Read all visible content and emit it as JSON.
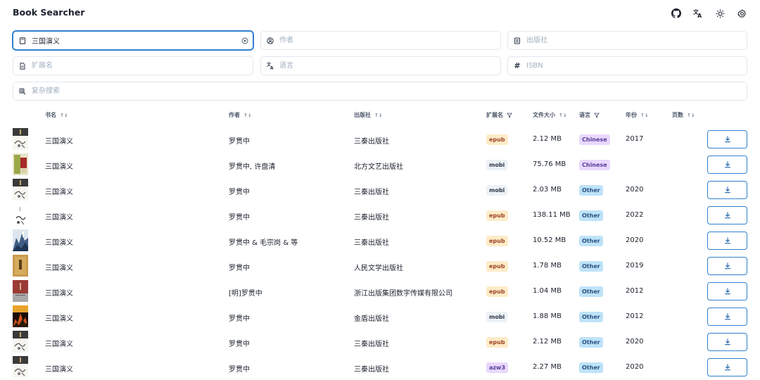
{
  "app": {
    "title": "Book Searcher"
  },
  "header_icons": [
    "github-icon",
    "translate-icon",
    "sun-icon",
    "gear-icon"
  ],
  "search": {
    "title": {
      "value": "三国演义",
      "placeholder": "书名"
    },
    "author": {
      "value": "",
      "placeholder": "作者"
    },
    "publisher": {
      "value": "",
      "placeholder": "出版社"
    },
    "extension": {
      "value": "",
      "placeholder": "扩展名"
    },
    "language": {
      "value": "",
      "placeholder": "语言"
    },
    "isbn": {
      "value": "",
      "placeholder": "ISBN",
      "icon_glyph": "#"
    },
    "complex": {
      "value": "",
      "placeholder": "复杂搜索"
    }
  },
  "table": {
    "headers": {
      "title": "书名",
      "author": "作者",
      "publisher": "出版社",
      "extension": "扩展名",
      "filesize": "文件大小",
      "language": "语言",
      "year": "年份",
      "pages": "页数"
    },
    "sort_glyph": "↑↓",
    "rows": [
      {
        "title": "三国演义",
        "author": "罗贯中",
        "publisher": "三秦出版社",
        "extension": "epub",
        "filesize": "2.12 MB",
        "language": "Chinese",
        "year": "2017",
        "pages": "",
        "cover": "dark-ink"
      },
      {
        "title": "三国演义",
        "author": "罗贯中, 许盘清",
        "publisher": "北方文艺出版社",
        "extension": "mobi",
        "filesize": "75.76 MB",
        "language": "Chinese",
        "year": "",
        "pages": "",
        "cover": "green-red"
      },
      {
        "title": "三国演义",
        "author": "罗贯中",
        "publisher": "三秦出版社",
        "extension": "mobi",
        "filesize": "2.03 MB",
        "language": "Other",
        "year": "2020",
        "pages": "",
        "cover": "dark-ink"
      },
      {
        "title": "三国演义",
        "author": "罗贯中",
        "publisher": "三秦出版社",
        "extension": "epub",
        "filesize": "138.11 MB",
        "language": "Other",
        "year": "2022",
        "pages": "",
        "cover": "white-ink"
      },
      {
        "title": "三国演义",
        "author": "罗贯中 & 毛宗岗 & 等",
        "publisher": "三秦出版社",
        "extension": "epub",
        "filesize": "10.52 MB",
        "language": "Other",
        "year": "2020",
        "pages": "",
        "cover": "blue-mountain"
      },
      {
        "title": "三国演义",
        "author": "罗贯中",
        "publisher": "人民文学出版社",
        "extension": "epub",
        "filesize": "1.78 MB",
        "language": "Other",
        "year": "2019",
        "pages": "",
        "cover": "tan"
      },
      {
        "title": "三国演义",
        "author": "[明]罗贯中",
        "publisher": "浙江出版集团数字传媒有限公司",
        "extension": "epub",
        "filesize": "1.04 MB",
        "language": "Other",
        "year": "2012",
        "pages": "",
        "cover": "red-grey"
      },
      {
        "title": "三国演义",
        "author": "罗贯中",
        "publisher": "金盾出版社",
        "extension": "mobi",
        "filesize": "1.88 MB",
        "language": "Other",
        "year": "2012",
        "pages": "",
        "cover": "fire"
      },
      {
        "title": "三国演义",
        "author": "罗贯中",
        "publisher": "三秦出版社",
        "extension": "epub",
        "filesize": "2.12 MB",
        "language": "Other",
        "year": "2020",
        "pages": "",
        "cover": "dark-ink"
      },
      {
        "title": "三国演义",
        "author": "罗贯中",
        "publisher": "三秦出版社",
        "extension": "azw3",
        "filesize": "2.27 MB",
        "language": "Other",
        "year": "2020",
        "pages": "",
        "cover": "dark-ink"
      }
    ]
  },
  "colors": {
    "accent": "#3182ce",
    "epub_badge": "#feebc8",
    "mobi_badge": "#edf2f7",
    "azw3_badge": "#e9d8fd",
    "chinese_badge": "#e9d8fd",
    "other_badge": "#bee3f8"
  }
}
